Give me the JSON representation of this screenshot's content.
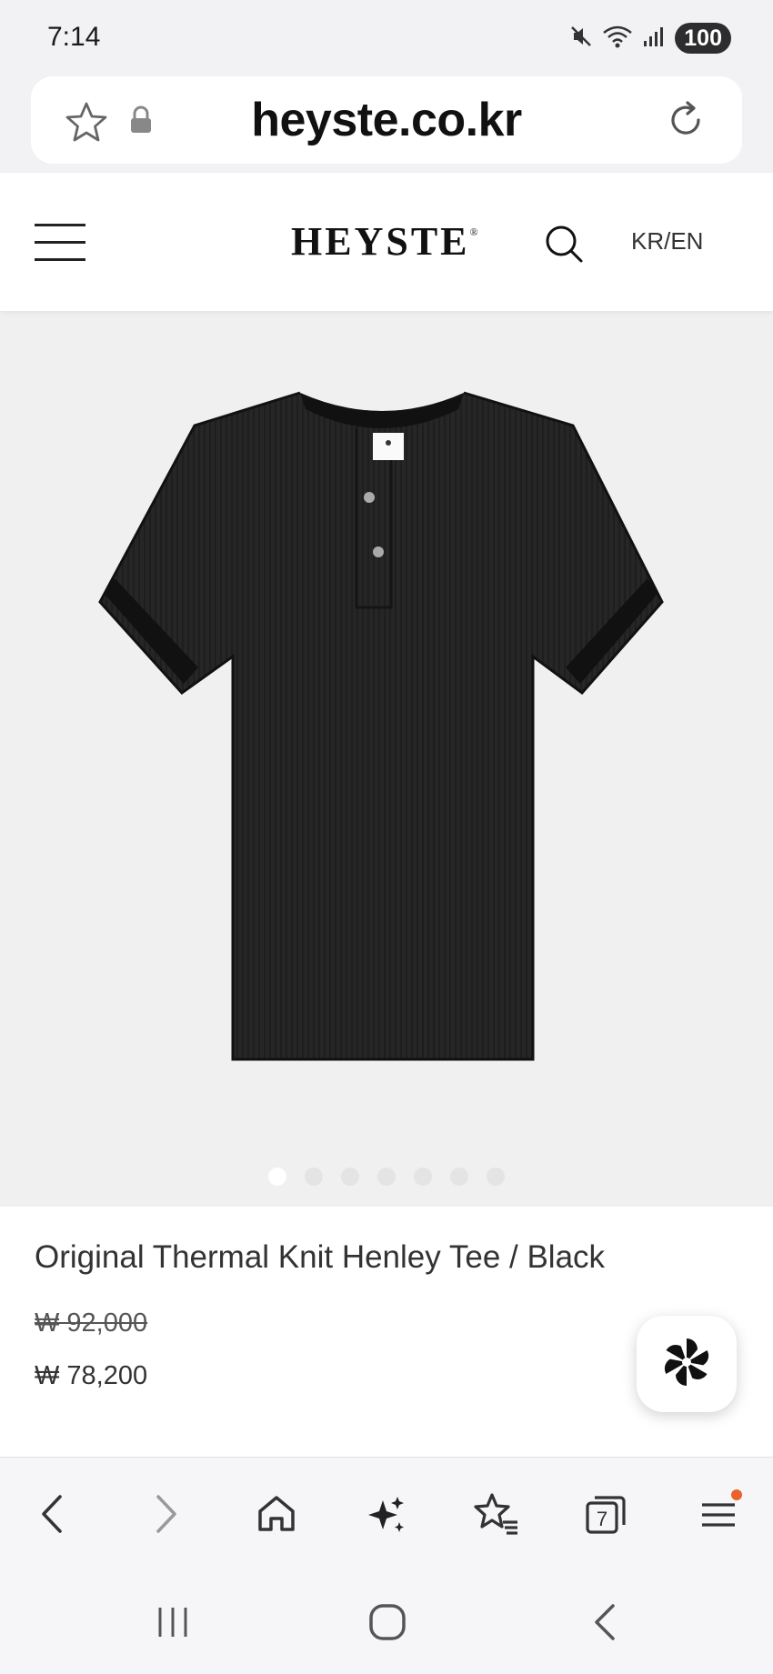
{
  "status_bar": {
    "time": "7:14",
    "battery": "100",
    "icons": [
      "mute-icon",
      "wifi-icon",
      "signal-icon",
      "battery-icon"
    ]
  },
  "address_bar": {
    "url": "heyste.co.kr",
    "icons": [
      "star-icon",
      "lock-icon",
      "reload-icon"
    ]
  },
  "site_header": {
    "logo": "HEYSTE",
    "logo_mark": "®",
    "language_toggle": "KR/EN",
    "icons": [
      "menu-icon",
      "search-icon"
    ]
  },
  "product": {
    "image_subject": "black short-sleeve henley tee",
    "image_colors": {
      "background": "#f0f0f0",
      "garment": "#262626",
      "trim": "#111111"
    },
    "carousel_total": 7,
    "carousel_active": 1,
    "name": "Original Thermal Knit Henley Tee / Black",
    "price_original": "₩ 92,000",
    "price_sale": "₩ 78,200"
  },
  "floating_button": {
    "icon": "pinwheel-icon"
  },
  "browser_nav": {
    "items": [
      "back-icon",
      "forward-icon",
      "home-icon",
      "sparkle-icon",
      "bookmarks-icon",
      "tabs-icon",
      "menu-icon"
    ],
    "tabs_count": "7",
    "notification_color": "#e8622e"
  },
  "system_nav": {
    "items": [
      "recents-icon",
      "home-icon",
      "back-icon"
    ]
  }
}
